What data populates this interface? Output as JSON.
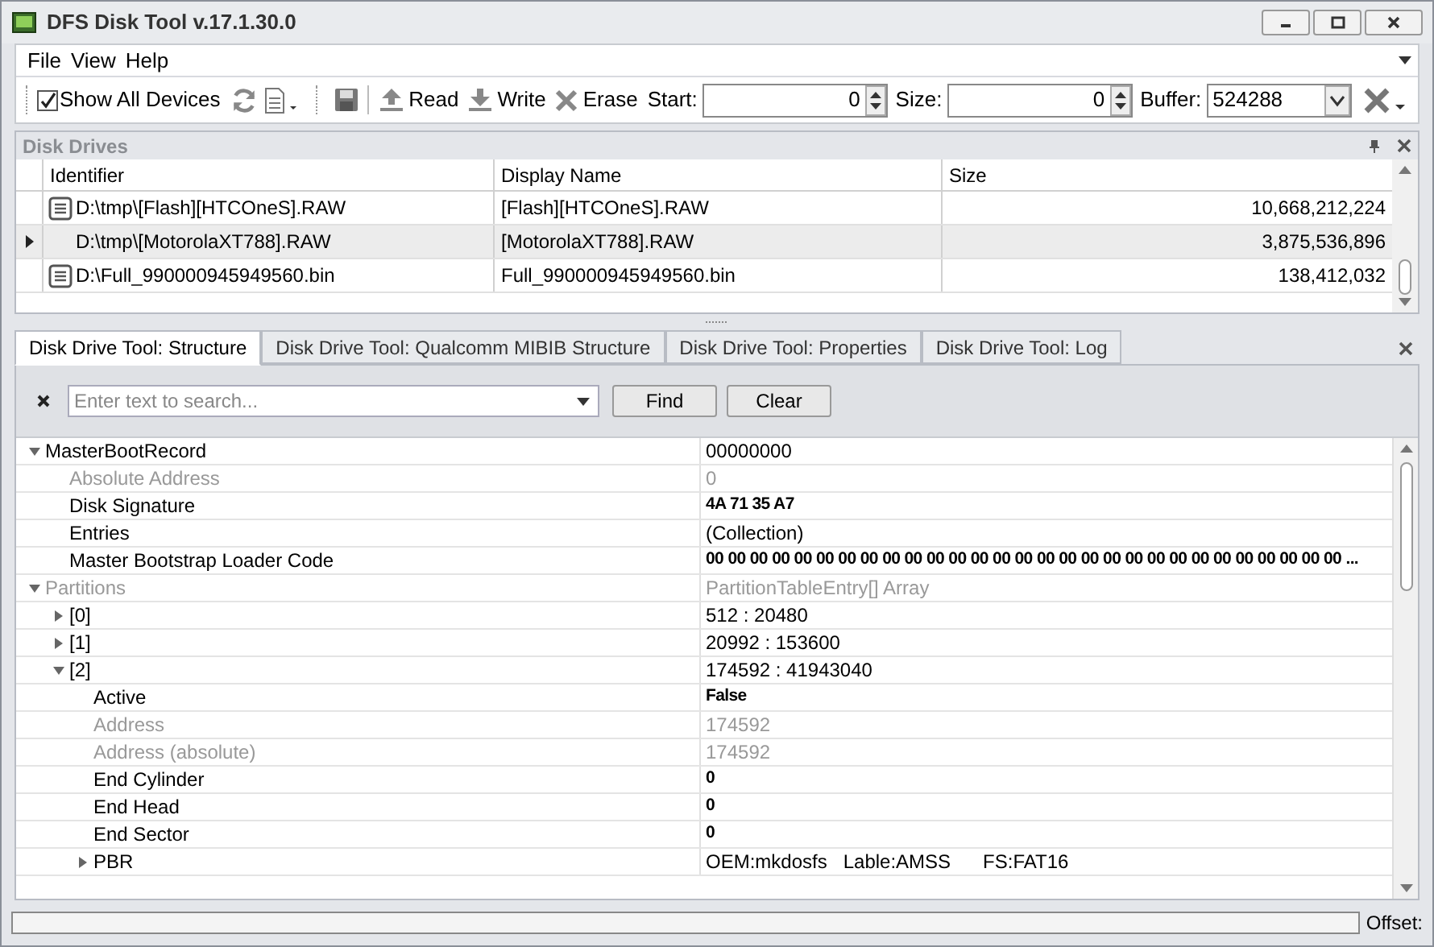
{
  "window": {
    "title": "DFS Disk Tool v.17.1.30.0"
  },
  "menu": [
    "File",
    "View",
    "Help"
  ],
  "toolbar": {
    "show_all": {
      "label": "Show All Devices",
      "checked": true
    },
    "read": "Read",
    "write": "Write",
    "erase": "Erase",
    "start": {
      "label": "Start:",
      "value": "0"
    },
    "size": {
      "label": "Size:",
      "value": "0"
    },
    "buffer": {
      "label": "Buffer:",
      "value": "524288"
    }
  },
  "disk_drives": {
    "title": "Disk Drives",
    "columns": [
      "Identifier",
      "Display Name",
      "Size"
    ],
    "rows": [
      {
        "identifier": "D:\\tmp\\[Flash][HTCOneS].RAW",
        "display_name": "[Flash][HTCOneS].RAW",
        "size": "10,668,212,224",
        "selected": false,
        "file_icon": true
      },
      {
        "identifier": "D:\\tmp\\[MotorolaXT788].RAW",
        "display_name": "[MotorolaXT788].RAW",
        "size": "3,875,536,896",
        "selected": true,
        "file_icon": false
      },
      {
        "identifier": "D:\\Full_990000945949560.bin",
        "display_name": "Full_990000945949560.bin",
        "size": "138,412,032",
        "selected": false,
        "file_icon": true
      }
    ]
  },
  "tabs": [
    {
      "label": "Disk Drive Tool: Structure",
      "selected": true
    },
    {
      "label": "Disk Drive Tool: Qualcomm MIBIB Structure",
      "selected": false
    },
    {
      "label": "Disk Drive Tool: Properties",
      "selected": false
    },
    {
      "label": "Disk Drive Tool: Log",
      "selected": false
    }
  ],
  "search": {
    "placeholder": "Enter text to search...",
    "find": "Find",
    "clear": "Clear"
  },
  "properties": [
    {
      "name": "MasterBootRecord",
      "value": "00000000",
      "expanded": true,
      "disabled": false,
      "bold": false,
      "children": [
        {
          "name": "Absolute Address",
          "value": "0",
          "disabled": true,
          "bold": false
        },
        {
          "name": "Disk Signature",
          "value": "4A 71 35 A7",
          "disabled": false,
          "bold": true
        },
        {
          "name": "Entries",
          "value": "(Collection)",
          "disabled": false,
          "bold": false
        },
        {
          "name": "Master Bootstrap Loader Code",
          "value": "00 00 00 00 00 00 00 00 00 00 00 00 00 00 00 00 00 00 00 00 00 00 00 00 00 00 00 00 00 ...",
          "disabled": false,
          "bold": true
        }
      ]
    },
    {
      "name": "Partitions",
      "value": "PartitionTableEntry[] Array",
      "expanded": true,
      "disabled": true,
      "bold": false,
      "children": [
        {
          "name": "[0]",
          "value": "512 : 20480",
          "expanded": false,
          "disabled": false,
          "bold": false
        },
        {
          "name": "[1]",
          "value": "20992 : 153600",
          "expanded": false,
          "disabled": false,
          "bold": false
        },
        {
          "name": "[2]",
          "value": "174592 : 41943040",
          "expanded": true,
          "disabled": false,
          "bold": false,
          "children": [
            {
              "name": "Active",
              "value": "False",
              "disabled": false,
              "bold": true
            },
            {
              "name": "Address",
              "value": "174592",
              "disabled": true,
              "bold": false
            },
            {
              "name": "Address (absolute)",
              "value": "174592",
              "disabled": true,
              "bold": false
            },
            {
              "name": "End Cylinder",
              "value": "0",
              "disabled": false,
              "bold": true
            },
            {
              "name": "End Head",
              "value": "0",
              "disabled": false,
              "bold": true
            },
            {
              "name": "End Sector",
              "value": "0",
              "disabled": false,
              "bold": true
            },
            {
              "name": "PBR",
              "value": "OEM:mkdosfs   Lable:AMSS      FS:FAT16",
              "expanded": false,
              "disabled": false,
              "bold": false
            }
          ]
        }
      ]
    }
  ],
  "status_bar": {
    "progress": {
      "level": 0
    },
    "offset_label": "Offset:"
  }
}
